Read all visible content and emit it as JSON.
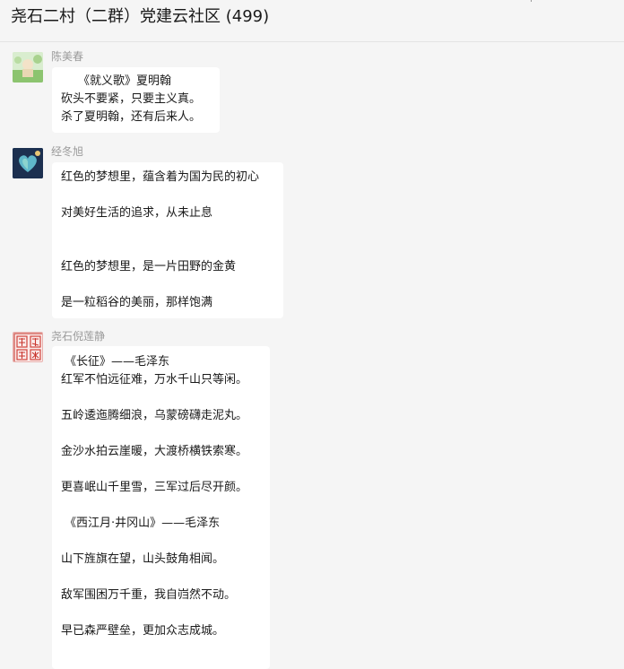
{
  "header": {
    "title": "尧石二村（二群）党建云社区 (499)",
    "more_icon": "more-icon"
  },
  "messages": [
    {
      "sender": "陈美春",
      "avatar_icon": "photo-avatar",
      "lines": [
        "《就义歌》夏明翰",
        "砍头不要紧，只要主义真。",
        "杀了夏明翰，还有后来人。"
      ]
    },
    {
      "sender": "经冬旭",
      "avatar_icon": "heart-photo-avatar",
      "lines": [
        "红色的梦想里，蕴含着为国为民的初心",
        "对美好生活的追求，从未止息",
        "红色的梦想里，是一片田野的金黄",
        "是一粒稻谷的美丽，那样饱满"
      ]
    },
    {
      "sender": "尧石倪莲静",
      "avatar_icon": "seal-stamp-avatar",
      "lines": [
        "《长征》——毛泽东",
        "红军不怕远征难，万水千山只等闲。",
        "五岭逶迤腾细浪，乌蒙磅礴走泥丸。",
        "金沙水拍云崖暖，大渡桥横铁索寒。",
        "更喜岷山千里雪，三军过后尽开颜。",
        "《西江月·井冈山》——毛泽东",
        "山下旌旗在望，山头鼓角相闻。",
        "敌军围困万千重，我自岿然不动。",
        "早已森严壁垒，更加众志成城。"
      ]
    }
  ]
}
